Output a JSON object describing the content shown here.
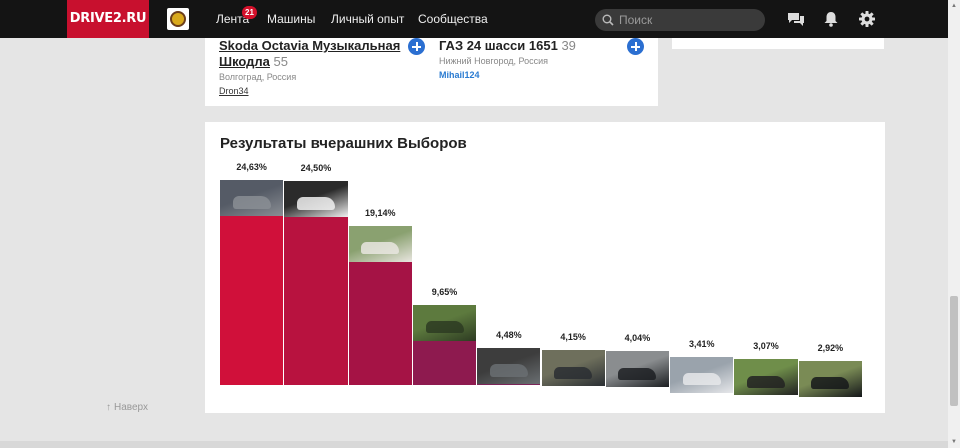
{
  "topbar": {
    "logo": "DRIVE2.RU",
    "nav": [
      {
        "label": "Лента",
        "badge": "21"
      },
      {
        "label": "Машины"
      },
      {
        "label": "Личный опыт"
      },
      {
        "label": "Сообщества"
      }
    ],
    "search_placeholder": "Поиск",
    "icons": [
      "messages-icon",
      "bell-icon",
      "gear-icon"
    ]
  },
  "cars": [
    {
      "title_line1": "Skoda Octavia Музыкальная",
      "title_line2": "Шкодла",
      "count": "55",
      "location": "Волгоград, Россия",
      "user": "Dron34"
    },
    {
      "title_line1": "ГАЗ 24 шасси 1651",
      "count": "39",
      "location": "Нижний Новгород, Россия",
      "user": "Mihail124"
    }
  ],
  "results": {
    "title": "Результаты вчерашних Выборов",
    "back_to_top": "Наверх"
  },
  "chart_data": {
    "type": "bar",
    "values": [
      24.63,
      24.5,
      19.14,
      9.65,
      4.48,
      4.15,
      4.04,
      3.41,
      3.07,
      2.92
    ],
    "labels": [
      "24,63%",
      "24,50%",
      "19,14%",
      "9,65%",
      "4,48%",
      "4,15%",
      "4,04%",
      "3,41%",
      "3,07%",
      "2,92%"
    ],
    "colors": [
      "#d0103a",
      "#b8123f",
      "#a51345",
      "#8e1a4f",
      "#7b2458",
      "#6e2b62",
      "#5e326c",
      "#4a3b7a",
      "#3a4788",
      "#2d4f96"
    ],
    "photo_colors": [
      [
        "#555b66",
        "#8a8e94"
      ],
      [
        "#2b2b2b",
        "#f0f0f0"
      ],
      [
        "#8aa170",
        "#e9e6e0"
      ],
      [
        "#5d7a3e",
        "#2d3b22"
      ],
      [
        "#3d3d3d",
        "#6a6f72"
      ],
      [
        "#6e6f5c",
        "#2a2e33"
      ],
      [
        "#8a8d8f",
        "#1c1f22"
      ],
      [
        "#9aa3ac",
        "#e6e7ea"
      ],
      [
        "#6f8e4a",
        "#222"
      ],
      [
        "#7a8b55",
        "#15171a"
      ]
    ]
  }
}
